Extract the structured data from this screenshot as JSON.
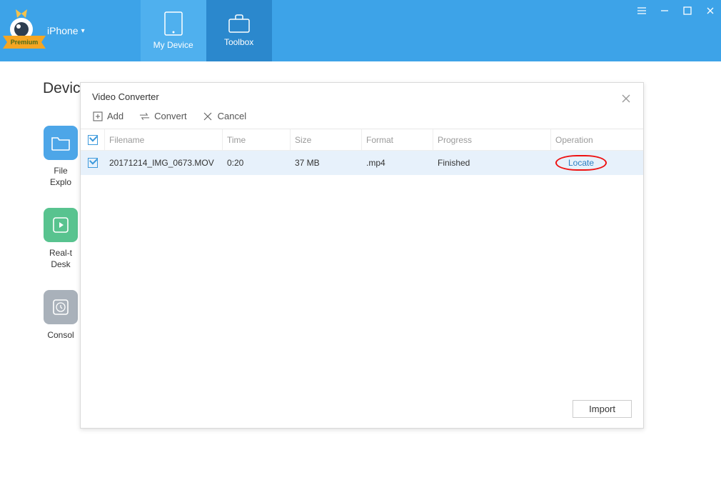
{
  "header": {
    "premium_label": "Premium",
    "device_label": "iPhone",
    "nav": [
      {
        "label": "My Device"
      },
      {
        "label": "Toolbox"
      }
    ]
  },
  "background": {
    "section_heading_partial": "Devic",
    "tools": [
      {
        "label_line1": "File",
        "label_line2": "Explo"
      },
      {
        "label_line1": "Real-t",
        "label_line2": "Desk"
      },
      {
        "label_line1": "Consol",
        "label_line2": ""
      }
    ]
  },
  "modal": {
    "title": "Video Converter",
    "toolbar": {
      "add_label": "Add",
      "convert_label": "Convert",
      "cancel_label": "Cancel"
    },
    "columns": {
      "filename": "Filename",
      "time": "Time",
      "size": "Size",
      "format": "Format",
      "progress": "Progress",
      "operation": "Operation"
    },
    "rows": [
      {
        "checked": true,
        "filename": "20171214_IMG_0673.MOV",
        "time": "0:20",
        "size": "37 MB",
        "format": ".mp4",
        "progress": "Finished",
        "operation_label": "Locate"
      }
    ],
    "import_label": "Import"
  }
}
